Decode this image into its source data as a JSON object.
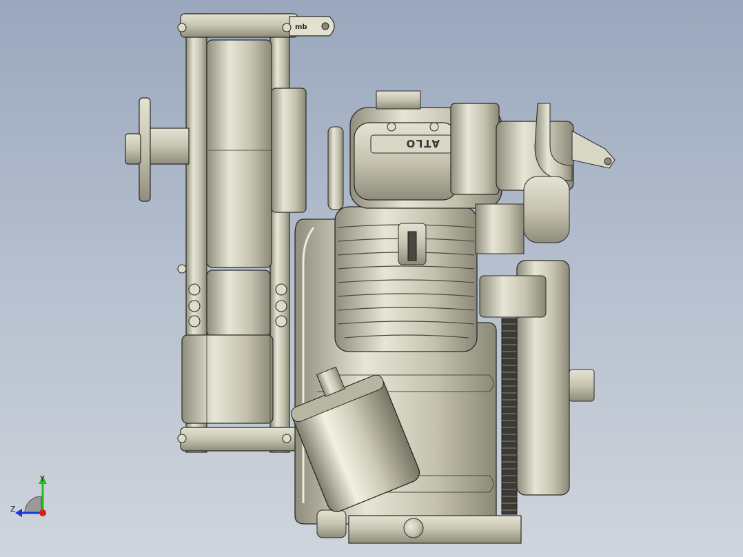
{
  "model": {
    "cylinder_engraving": "ATLO",
    "tag_text": "mb"
  },
  "triad": {
    "y_label": "Y",
    "z_label": "Z"
  },
  "colors": {
    "background_top": "#9aa7bd",
    "background_bottom": "#cfd5dc",
    "part_fill": "#c9c7b3",
    "part_light": "#e6e4d4",
    "part_dark": "#8d8b79",
    "edge": "#2a2a26",
    "axis_y": "#1fbf1f",
    "axis_x": "#e01919",
    "axis_z": "#1a35d6"
  }
}
